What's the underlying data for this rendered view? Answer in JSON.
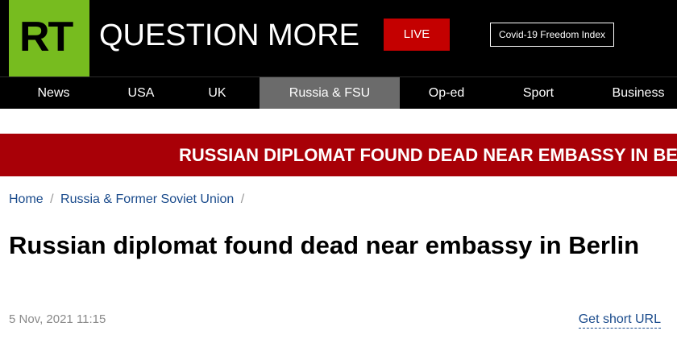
{
  "header": {
    "logo_text": "RT",
    "tagline": "QUESTION MORE",
    "live_label": "LIVE",
    "covid_link": "Covid-19 Freedom Index"
  },
  "nav": {
    "items": [
      {
        "label": "News"
      },
      {
        "label": "USA"
      },
      {
        "label": "UK"
      },
      {
        "label": "Russia & FSU",
        "active": true
      },
      {
        "label": "Op-ed"
      },
      {
        "label": "Sport"
      },
      {
        "label": "Business"
      }
    ]
  },
  "banner": {
    "text": "RUSSIAN DIPLOMAT FOUND DEAD NEAR EMBASSY IN BERLIN"
  },
  "breadcrumb": {
    "items": [
      "Home",
      "Russia & Former Soviet Union"
    ],
    "separator": "/"
  },
  "article": {
    "title": "Russian diplomat found dead near embassy in Berlin",
    "date": "5 Nov, 2021 11:15",
    "short_url_label": "Get short URL"
  },
  "colors": {
    "brand_green": "#77bc1f",
    "live_red": "#c40000",
    "banner_red": "#a80007",
    "link_blue": "#1a4b8c",
    "nav_active": "#6b6b6b"
  }
}
